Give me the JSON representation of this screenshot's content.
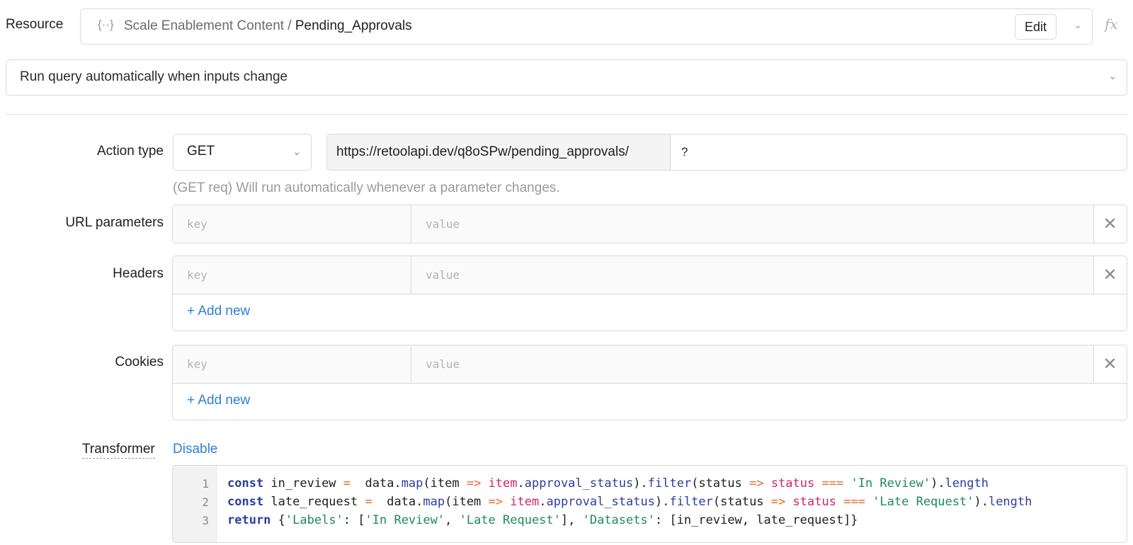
{
  "resource": {
    "label": "Resource",
    "icon": "braces-icon",
    "path_prefix": "Scale Enablement Content / ",
    "name": "Pending_Approvals",
    "edit_label": "Edit",
    "fx_label": "fx"
  },
  "run_mode": {
    "value": "Run query automatically when inputs change"
  },
  "action": {
    "label": "Action type",
    "method": "GET",
    "url_base": "https://retoolapi.dev/q8oSPw/pending_approvals/",
    "url_query": "?",
    "hint": "(GET req) Will run automatically whenever a parameter changes."
  },
  "url_params": {
    "label": "URL parameters",
    "key_placeholder": "key",
    "value_placeholder": "value"
  },
  "headers": {
    "label": "Headers",
    "key_placeholder": "key",
    "value_placeholder": "value",
    "add_label": "+ Add new"
  },
  "cookies": {
    "label": "Cookies",
    "key_placeholder": "key",
    "value_placeholder": "value",
    "add_label": "+ Add new"
  },
  "transformer": {
    "label": "Transformer",
    "disable_label": "Disable",
    "line_numbers": [
      "1",
      "2",
      "3"
    ],
    "lines": [
      "const in_review =  data.map(item => item.approval_status).filter(status => status === 'In Review').length",
      "const late_request =  data.map(item => item.approval_status).filter(status => status === 'Late Request').length",
      "return {'Labels': ['In Review', 'Late Request'], 'Datasets': [in_review, late_request]}"
    ]
  }
}
